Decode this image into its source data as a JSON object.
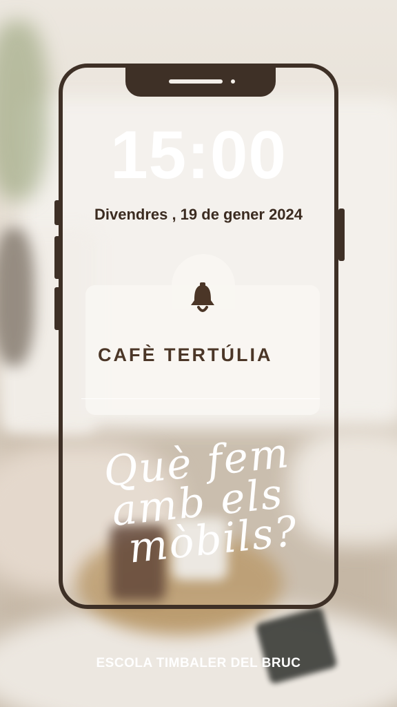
{
  "lockscreen": {
    "time": "15:00",
    "date": "Divendres , 19 de gener 2024"
  },
  "notification": {
    "icon": "bell-icon",
    "title": "CAFÈ TERTÚLIA"
  },
  "headline": {
    "line1": "Què fem",
    "line2": "amb els",
    "line3": "mòbils?"
  },
  "footer": {
    "school": "ESCOLA TIMBALER DEL BRUC"
  },
  "colors": {
    "frame": "#3e3026",
    "text_dark": "#3b2b20",
    "card": "#f8f6f2"
  }
}
